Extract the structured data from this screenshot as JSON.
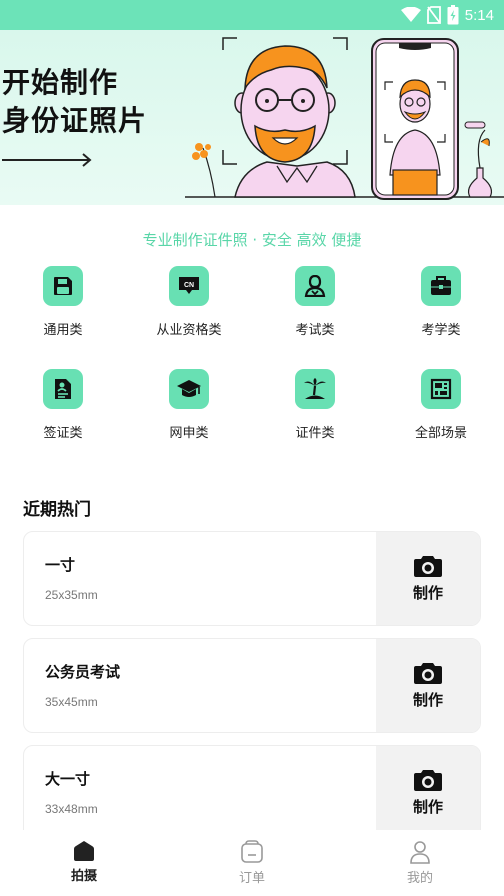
{
  "status_bar": {
    "time": "5:14"
  },
  "banner": {
    "title_line1": "开始制作",
    "title_line2": "身份证照片"
  },
  "tagline": "专业制作证件照 · 安全 高效 便捷",
  "categories": [
    {
      "label": "通用类",
      "icon": "floppy-disk-icon"
    },
    {
      "label": "从业资格类",
      "icon": "cn-badge-icon"
    },
    {
      "label": "考试类",
      "icon": "user-badge-icon"
    },
    {
      "label": "考学类",
      "icon": "briefcase-icon"
    },
    {
      "label": "签证类",
      "icon": "visa-document-icon"
    },
    {
      "label": "网申类",
      "icon": "graduation-cap-icon"
    },
    {
      "label": "证件类",
      "icon": "palm-tree-icon"
    },
    {
      "label": "全部场景",
      "icon": "grid-scenes-icon"
    }
  ],
  "hot_section": {
    "title": "近期热门",
    "items": [
      {
        "name": "一寸",
        "size": "25x35mm",
        "action": "制作"
      },
      {
        "name": "公务员考试",
        "size": "35x45mm",
        "action": "制作"
      },
      {
        "name": "大一寸",
        "size": "33x48mm",
        "action": "制作"
      }
    ]
  },
  "nav": {
    "items": [
      {
        "label": "拍摄",
        "icon": "home-icon",
        "active": true
      },
      {
        "label": "订单",
        "icon": "order-icon",
        "active": false
      },
      {
        "label": "我的",
        "icon": "profile-icon",
        "active": false
      }
    ]
  },
  "colors": {
    "accent": "#68e0b3",
    "status_bar": "#6ce3b8",
    "character_orange": "#f7931e"
  }
}
